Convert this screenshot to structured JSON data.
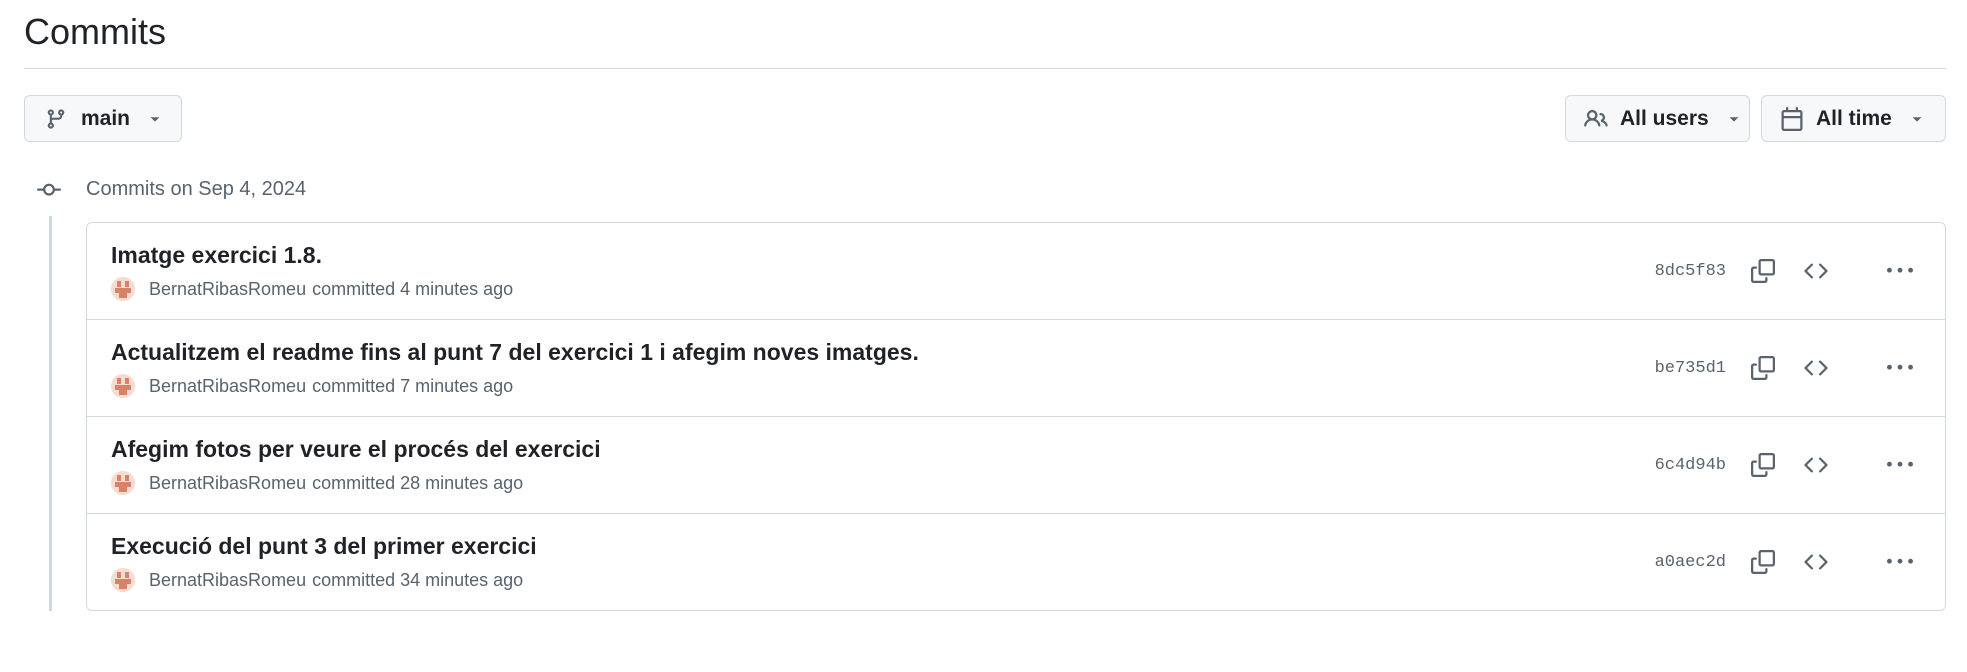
{
  "page": {
    "title": "Commits"
  },
  "filters": {
    "branch_label": "main",
    "users_label": "All users",
    "time_label": "All time"
  },
  "date_group": {
    "heading": "Commits on Sep 4, 2024"
  },
  "commits": [
    {
      "title": "Imatge exercici 1.8.",
      "author": "BernatRibasRomeu",
      "meta": "committed 4 minutes ago",
      "sha": "8dc5f83"
    },
    {
      "title": "Actualitzem el readme fins al punt 7 del exercici 1 i afegim noves imatges.",
      "author": "BernatRibasRomeu",
      "meta": "committed 7 minutes ago",
      "sha": "be735d1"
    },
    {
      "title": "Afegim fotos per veure el procés del exercici",
      "author": "BernatRibasRomeu",
      "meta": "committed 28 minutes ago",
      "sha": "6c4d94b"
    },
    {
      "title": "Execució del punt 3 del primer exercici",
      "author": "BernatRibasRomeu",
      "meta": "committed 34 minutes ago",
      "sha": "a0aec2d"
    }
  ],
  "colors": {
    "text_primary": "#1f2328",
    "text_muted": "#59636e",
    "border": "#d1d9e0",
    "button_bg": "#f6f8fa",
    "avatar_accent": "#d9826a"
  },
  "icons": {
    "branch": "git-branch-icon",
    "users": "people-icon",
    "time": "calendar-icon",
    "caret": "triangle-down-icon",
    "node": "git-commit-icon",
    "copy": "copy-icon",
    "browse": "code-icon",
    "more": "kebab-horizontal-icon"
  }
}
